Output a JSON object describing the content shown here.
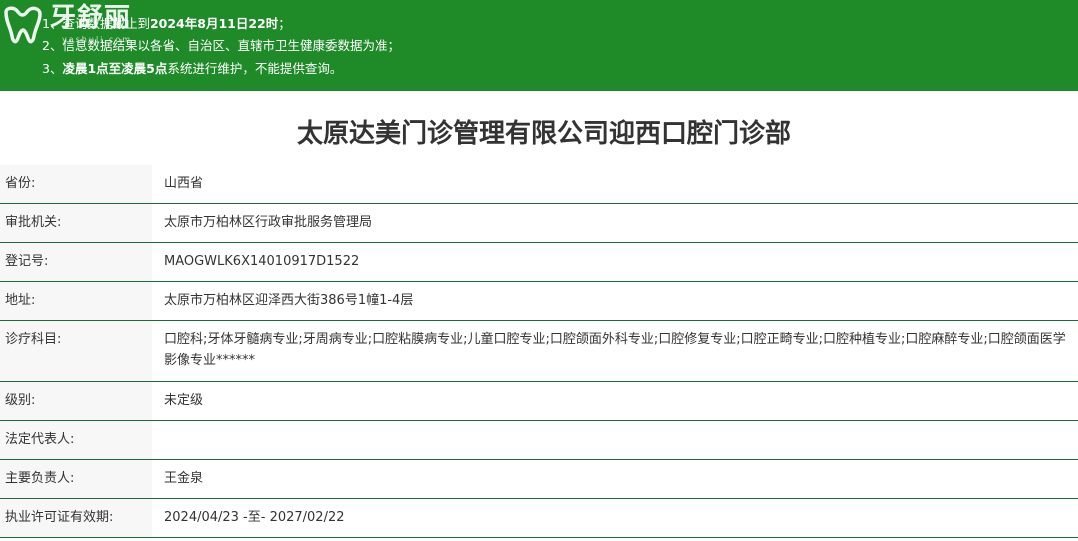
{
  "banner": {
    "logo_text": "牙舒丽",
    "logo_sub": "yashuli.com",
    "notice_1_prefix": "1、查询数据截止到",
    "notice_1_date": "2024年8月11日22时",
    "notice_1_suffix": "；",
    "notice_2": "2、信息数据结果以各省、自治区、直辖市卫生健康委数据为准；",
    "notice_3_prefix": "3、",
    "notice_3_bold": "凌晨1点至凌晨5点",
    "notice_3_suffix": "系统进行维护，不能提供查询。",
    "background_color": "#1e8a28"
  },
  "title": "太原达美门诊管理有限公司迎西口腔门诊部",
  "rows": [
    {
      "label": "省份:",
      "value": "山西省"
    },
    {
      "label": "审批机关:",
      "value": "太原市万柏林区行政审批服务管理局"
    },
    {
      "label": "登记号:",
      "value": "MAOGWLK6X14010917D1522"
    },
    {
      "label": "地址:",
      "value": "太原市万柏林区迎泽西大街386号1幢1-4层"
    },
    {
      "label": "诊疗科目:",
      "value": "口腔科;牙体牙髓病专业;牙周病专业;口腔粘膜病专业;儿童口腔专业;口腔颌面外科专业;口腔修复专业;口腔正畸专业;口腔种植专业;口腔麻醉专业;口腔颌面医学影像专业******"
    },
    {
      "label": "级别:",
      "value": "未定级"
    },
    {
      "label": "法定代表人:",
      "value": ""
    },
    {
      "label": "主要负责人:",
      "value": "王金泉"
    },
    {
      "label": "执业许可证有效期:",
      "value": "2024/04/23 -至- 2027/02/22"
    }
  ],
  "colors": {
    "row_border": "#1a6b3a",
    "label_bg": "#f7f7f7"
  }
}
